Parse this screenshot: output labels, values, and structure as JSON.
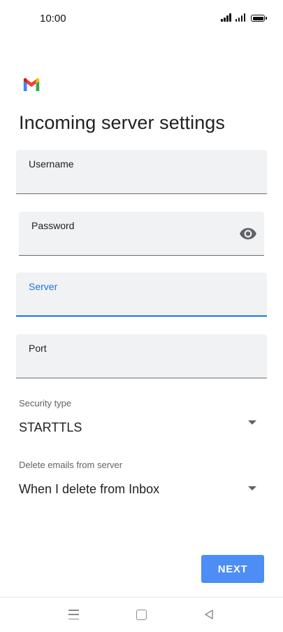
{
  "status_bar": {
    "time": "10:00",
    "icons": [
      "signal-icon",
      "signal-icon",
      "battery-icon"
    ]
  },
  "header": {
    "logo": "gmail-logo",
    "title": "Incoming server settings"
  },
  "form": {
    "username": {
      "label": "Username",
      "value": ""
    },
    "password": {
      "label": "Password",
      "value": "",
      "toggle_icon": "eye-icon"
    },
    "server": {
      "label": "Server",
      "value": ""
    },
    "port": {
      "label": "Port",
      "value": ""
    },
    "security_type": {
      "label": "Security type",
      "value": "STARTTLS"
    },
    "delete_emails": {
      "label": "Delete emails from server",
      "value": "When I delete from Inbox"
    }
  },
  "actions": {
    "next_label": "NEXT"
  },
  "nav_bar": {
    "icons": [
      "menu-icon",
      "home-icon",
      "back-icon"
    ]
  },
  "colors": {
    "accent": "#1a73e8",
    "button": "#4c8df6",
    "field_bg": "#f1f2f4",
    "text": "#202124",
    "muted": "#5f6368"
  }
}
